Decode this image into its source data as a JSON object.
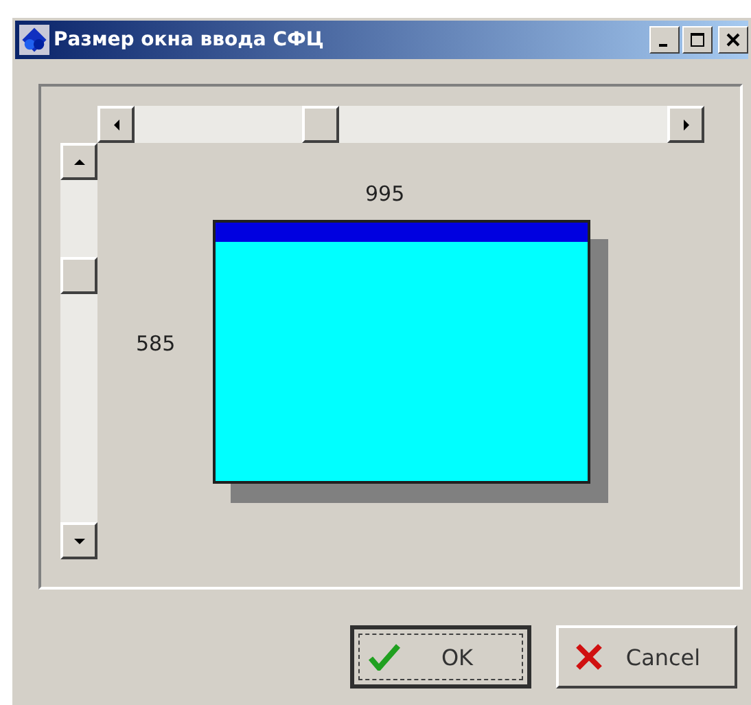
{
  "window": {
    "title": "Размер окна ввода СФЦ"
  },
  "preview": {
    "width_label": "995",
    "height_label": "585"
  },
  "buttons": [
    {
      "kind": "ok",
      "label": "OK",
      "focused": true
    },
    {
      "kind": "cancel",
      "label": "Cancel",
      "focused": false
    }
  ]
}
